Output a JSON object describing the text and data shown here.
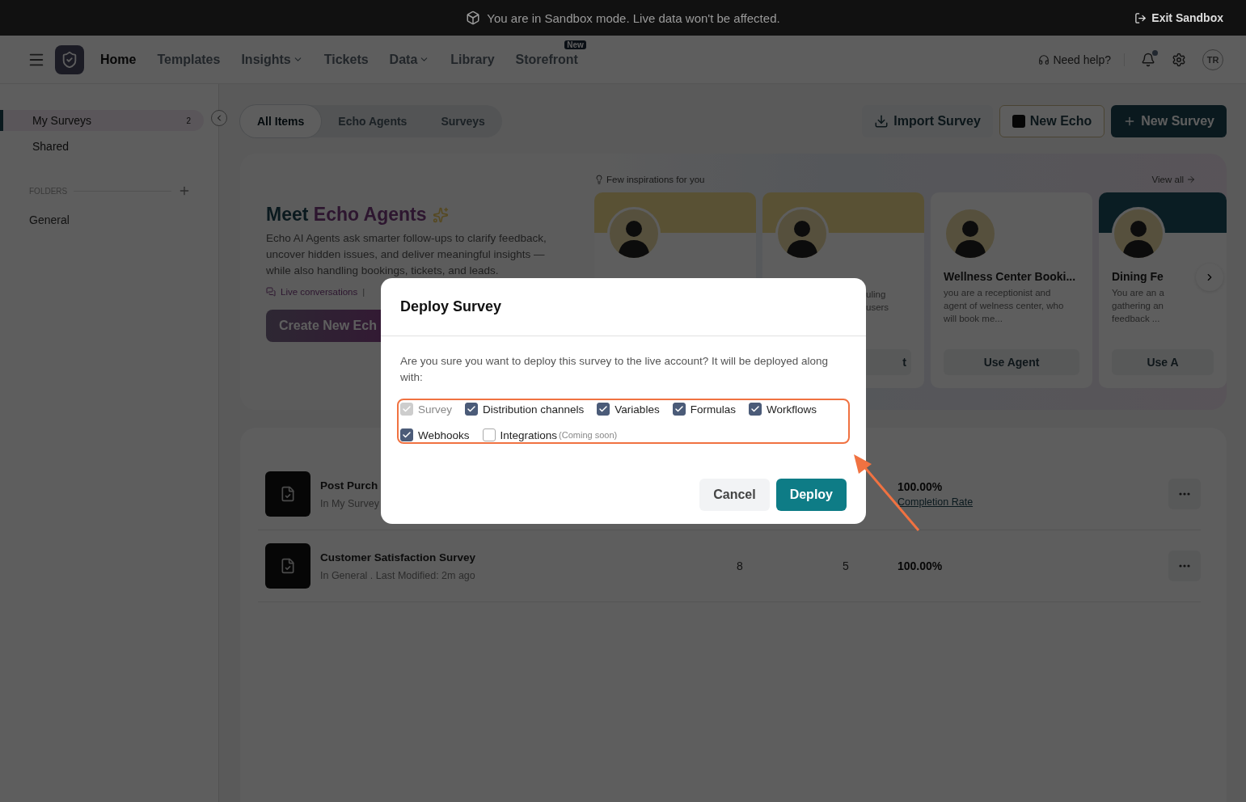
{
  "banner": {
    "message": "You are in Sandbox mode. Live data won't be affected.",
    "exit_label": "Exit Sandbox"
  },
  "nav": {
    "items": [
      {
        "label": "Home",
        "selected": true,
        "dropdown": false
      },
      {
        "label": "Templates",
        "selected": false,
        "dropdown": false
      },
      {
        "label": "Insights",
        "selected": false,
        "dropdown": true
      },
      {
        "label": "Tickets",
        "selected": false,
        "dropdown": false
      },
      {
        "label": "Data",
        "selected": false,
        "dropdown": true
      },
      {
        "label": "Library",
        "selected": false,
        "dropdown": false
      },
      {
        "label": "Storefront",
        "selected": false,
        "dropdown": false,
        "badge": "New"
      }
    ],
    "help_label": "Need help?",
    "avatar_initials": "TR"
  },
  "sidebar": {
    "items": [
      {
        "label": "My Surveys",
        "count": "2",
        "selected": true
      },
      {
        "label": "Shared",
        "selected": false
      }
    ],
    "folders_label": "FOLDERS",
    "folders": [
      {
        "label": "General"
      }
    ]
  },
  "tabs": [
    {
      "label": "All Items",
      "selected": true
    },
    {
      "label": "Echo Agents",
      "selected": false
    },
    {
      "label": "Surveys",
      "selected": false
    }
  ],
  "actions": [
    {
      "label": "Import Survey",
      "kind": "import"
    },
    {
      "label": "New Echo",
      "kind": "echo"
    },
    {
      "label": "New Survey",
      "kind": "primary"
    }
  ],
  "hero": {
    "title_lead": "Meet",
    "title_accent": "Echo Agents",
    "description": "Echo AI Agents ask smarter follow-ups to clarify feedback, uncover hidden issues, and deliver meaningful insights — while also handling bookings, tickets, and leads.",
    "meta": "Live conversations",
    "separator": "|",
    "cta": "Create New Ech"
  },
  "inspirations": {
    "heading": "Few inspirations for you",
    "view_all": "View all",
    "cards": [
      {
        "kind": "yellow"
      },
      {
        "kind": "yellow",
        "description_lines": [
          "uling",
          "users"
        ],
        "button": "t"
      },
      {
        "kind": "plain",
        "title": "Wellness Center Booki...",
        "description_lines": [
          "you are a receptionist and",
          "agent of welness center, who",
          "will book me..."
        ],
        "button": "Use Agent"
      },
      {
        "kind": "teal",
        "title": "Dining Fe",
        "description_lines": [
          "You are an a",
          "gathering an",
          "feedback ..."
        ],
        "button": "Use A"
      }
    ]
  },
  "surveys": [
    {
      "title": "Post Purch",
      "subtitle": "In My Survey",
      "rate": "100.00%",
      "rate_label": "Completion Rate"
    },
    {
      "title": "Customer Satisfaction Survey",
      "subtitle": "In General . Last Modified: 2m ago",
      "responses": "8",
      "questions": "5",
      "rate": "100.00%"
    }
  ],
  "dialog": {
    "title": "Deploy Survey",
    "message": "Are you sure you want to deploy this survey to the live account? It will be deployed along with:",
    "options": [
      {
        "label": "Survey",
        "checked": true,
        "disabled": true
      },
      {
        "label": "Distribution channels",
        "checked": true,
        "disabled": false
      },
      {
        "label": "Variables",
        "checked": true,
        "disabled": false
      },
      {
        "label": "Formulas",
        "checked": true,
        "disabled": false
      },
      {
        "label": "Workflows",
        "checked": true,
        "disabled": false
      },
      {
        "label": "Webhooks",
        "checked": true,
        "disabled": false
      },
      {
        "label": "Integrations",
        "checked": false,
        "disabled": false,
        "note": "(Coming soon)"
      }
    ],
    "buttons": [
      {
        "label": "Cancel",
        "kind": "secondary"
      },
      {
        "label": "Deploy",
        "kind": "primary"
      }
    ]
  }
}
